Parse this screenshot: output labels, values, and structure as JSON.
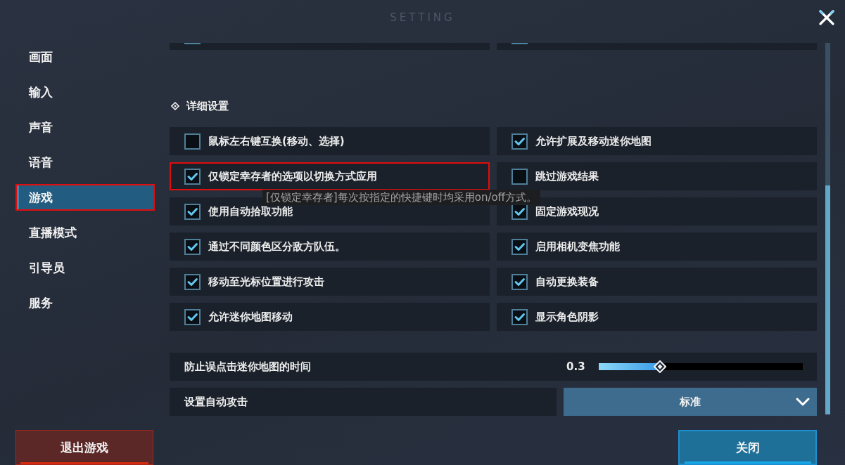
{
  "window": {
    "title": "SETTING"
  },
  "sidebar": {
    "items": [
      {
        "label": "画面",
        "selected": false,
        "highlighted": false
      },
      {
        "label": "输入",
        "selected": false,
        "highlighted": false
      },
      {
        "label": "声音",
        "selected": false,
        "highlighted": false
      },
      {
        "label": "语音",
        "selected": false,
        "highlighted": false
      },
      {
        "label": "游戏",
        "selected": true,
        "highlighted": true
      },
      {
        "label": "直播模式",
        "selected": false,
        "highlighted": false
      },
      {
        "label": "引导员",
        "selected": false,
        "highlighted": false
      },
      {
        "label": "服务",
        "selected": false,
        "highlighted": false
      }
    ]
  },
  "content": {
    "partial_rows": [
      {
        "kind": "checkbox"
      },
      {
        "kind": "checkbox"
      }
    ],
    "section": {
      "title": "详细设置"
    },
    "options": [
      {
        "label": "鼠标左右键互换(移动、选择)",
        "checked": false,
        "highlighted": false
      },
      {
        "label": "允许扩展及移动迷你地图",
        "checked": true,
        "highlighted": false
      },
      {
        "label": "仅锁定幸存者的选项以切换方式应用",
        "checked": true,
        "highlighted": true,
        "tooltip": "[仅锁定幸存者]每次按指定的快捷键时均采用on/off方式。"
      },
      {
        "label": "跳过游戏结果",
        "checked": false,
        "highlighted": false
      },
      {
        "label": "使用自动拾取功能",
        "checked": true,
        "highlighted": false
      },
      {
        "label": "固定游戏现况",
        "checked": true,
        "highlighted": false
      },
      {
        "label": "通过不同颜色区分敌方队伍。",
        "checked": true,
        "highlighted": false
      },
      {
        "label": "启用相机变焦功能",
        "checked": true,
        "highlighted": false
      },
      {
        "label": "移动至光标位置进行攻击",
        "checked": true,
        "highlighted": false
      },
      {
        "label": "自动更换装备",
        "checked": true,
        "highlighted": false
      },
      {
        "label": "允许迷你地图移动",
        "checked": true,
        "highlighted": false
      },
      {
        "label": "显示角色阴影",
        "checked": true,
        "highlighted": false
      }
    ],
    "slider": {
      "label": "防止误点击迷你地图的时间",
      "reading": "0.3",
      "level": 0.3
    },
    "dropdown": {
      "label": "设置自动攻击",
      "value": "标准"
    }
  },
  "footer": {
    "buttons": [
      {
        "label": "退出游戏",
        "kind": "exit"
      },
      {
        "label": "关闭",
        "kind": "close"
      }
    ]
  }
}
